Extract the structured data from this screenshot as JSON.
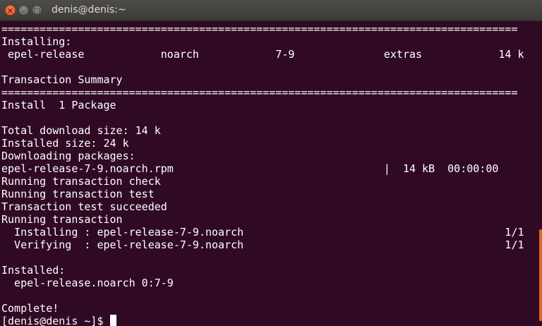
{
  "window": {
    "title": "denis@denis:~",
    "close_glyph": "✕",
    "minimize_glyph": "–",
    "maximize_glyph": "□"
  },
  "terminal": {
    "lines": [
      "=================================================================================",
      "Installing:",
      " epel-release            noarch            7-9              extras            14 k",
      "",
      "Transaction Summary",
      "=================================================================================",
      "Install  1 Package",
      "",
      "Total download size: 14 k",
      "Installed size: 24 k",
      "Downloading packages:",
      "epel-release-7-9.noarch.rpm                                 |  14 kB  00:00:00",
      "Running transaction check",
      "Running transaction test",
      "Transaction test succeeded",
      "Running transaction",
      "  Installing : epel-release-7-9.noarch                                         1/1",
      "  Verifying  : epel-release-7-9.noarch                                         1/1",
      "",
      "Installed:",
      "  epel-release.noarch 0:7-9",
      "",
      "Complete!"
    ],
    "prompt": "[denis@denis ~]$ "
  },
  "colors": {
    "background": "#300a24",
    "text": "#ffffff",
    "titlebar": "#3c3b37",
    "close_button": "#e4501d",
    "scrollbar": "#e0672a"
  }
}
